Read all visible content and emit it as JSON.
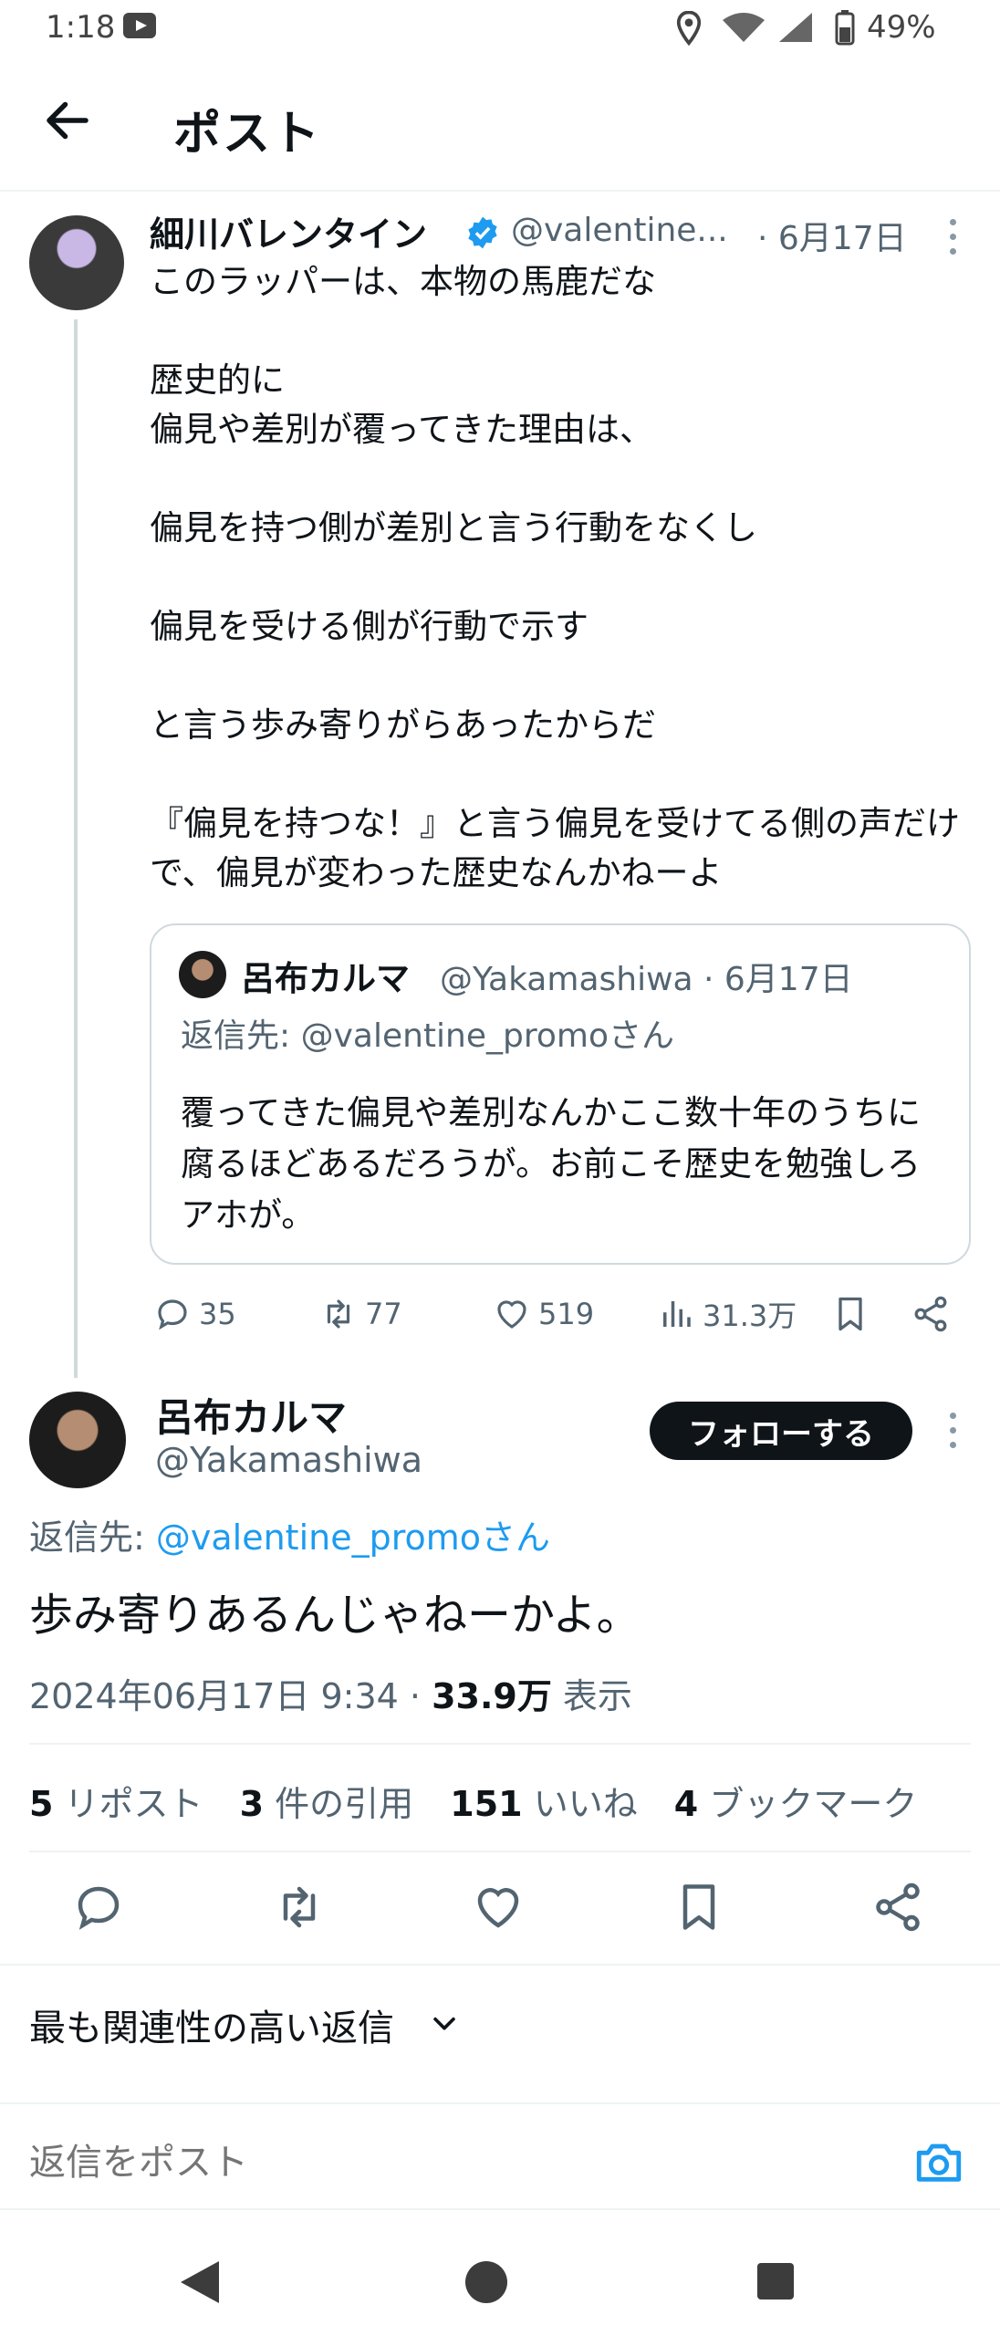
{
  "status_bar": {
    "time": "1:18",
    "battery": "49%"
  },
  "header": {
    "title": "ポスト"
  },
  "tweet1": {
    "name": "細川バレンタイン",
    "handle": "@valentine...",
    "date": "· 6月17日",
    "body": "このラッパーは、本物の馬鹿だな\n\n歴史的に\n偏見や差別が覆ってきた理由は、\n\n偏見を持つ側が差別と言う行動をなくし\n\n偏見を受ける側が行動で示す\n\nと言う歩み寄りがらあったからだ\n\n『偏見を持つな！』と言う偏見を受けてる側の声だけで、偏見が変わった歴史なんかねーよ",
    "actions": {
      "replies": "35",
      "reposts": "77",
      "likes": "519",
      "views": "31.3万"
    }
  },
  "quote": {
    "name": "呂布カルマ",
    "handle": "@Yakamashiwa · 6月17日",
    "reply_to": "返信先: @valentine_promoさん",
    "body": "覆ってきた偏見や差別なんかここ数十年のうちに腐るほどあるだろうが。お前こそ歴史を勉強しろアホが。"
  },
  "tweet2": {
    "name": "呂布カルマ",
    "handle": "@Yakamashiwa",
    "follow_label": "フォローする",
    "reply_prefix": "返信先: ",
    "reply_target": "@valentine_promoさん",
    "body": "歩み寄りあるんじゃねーかよ。",
    "timestamp": "2024年06月17日 9:34 · ",
    "views_count": "33.9万",
    "views_label": " 表示",
    "stats": [
      {
        "count": "5",
        "label": " リポスト"
      },
      {
        "count": "3",
        "label": " 件の引用"
      },
      {
        "count": "151",
        "label": " いいね"
      },
      {
        "count": "4",
        "label": " ブックマーク"
      }
    ]
  },
  "replies": {
    "sort_label": "最も関連性の高い返信"
  },
  "composer": {
    "placeholder": "返信をポスト"
  },
  "colors": {
    "accent": "#1d9bf0",
    "text": "#0f1419",
    "muted": "#536471",
    "border": "#cfd9de"
  }
}
